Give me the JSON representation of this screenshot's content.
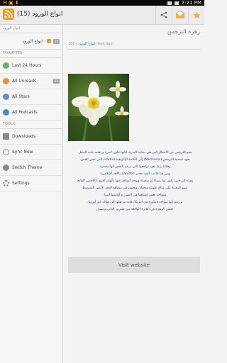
{
  "status_bar": {
    "time": "7:21 PM"
  },
  "action_bar": {
    "title": "انواع الورود (15)"
  },
  "sidebar": {
    "feeds_header": "انواع الورود",
    "feeds": [
      {
        "label": "انواع الورود",
        "count": "15"
      }
    ],
    "favorites_header": "FAVORITES",
    "favorites": [
      {
        "label": "Last 24 Hours",
        "icon": "clock-icon",
        "count": ""
      },
      {
        "label": "All Unreads",
        "icon": "unread-icon",
        "count": "15"
      },
      {
        "label": "All Stars",
        "icon": "star-icon",
        "count": ""
      },
      {
        "label": "All Podcasts",
        "icon": "podcast-icon",
        "count": ""
      }
    ],
    "tools_header": "TOOLS",
    "tools": [
      {
        "label": "Downloads",
        "icon": "download-icon"
      },
      {
        "label": "Sync Now",
        "icon": "sync-icon"
      },
      {
        "label": "Switch Theme",
        "icon": "theme-icon"
      },
      {
        "label": "Settings",
        "icon": "settings-icon"
      }
    ]
  },
  "article": {
    "title": "زهرة النرجس",
    "meta_feed": "انواع الورود",
    "meta_info": " | 386 days ago",
    "paragraphs": [
      "ينمو النرجس من الأبصال التي هي بمثابة البذرة، لكنها تكون كبيرة و تشبه نبات البصل.",
      "يعود تسمية النرجس (Narcissus) إلى الكلمة الإغريقية (narke) التي تعني الغش،",
      "وهكذا ربما يعود تراجعها التي يزعم البعض أنها مخدرة.",
      "ومن هنا جاءت كلمة مخدر narcotic باللغة الإنكليزية.",
      "زهرة النرجس تكون إما بيضاء أو صفراء ويوجد أصناف منها بألوان أخرى كالأخضر الفاتح.",
      "تنمو الزهرة على ساق طويلة ونحيلة، وتعيش في منطقة البحر الأبيض المتوسط",
      "وتتواجد بعض أصنافها في الصين و أواسط آسيا.",
      "و رغم أنها متواجدة بكثرة في أمريكا، فإنه تم نقلها إلى هناك عبر أوروبا.",
      "تعيش الزهرة في الفترة الواقعة بين تشرين الثاني ونيسان"
    ],
    "visit_label": "Visit website"
  },
  "colors": {
    "accent": "#f19b2a",
    "text_blue": "#243a8b"
  }
}
